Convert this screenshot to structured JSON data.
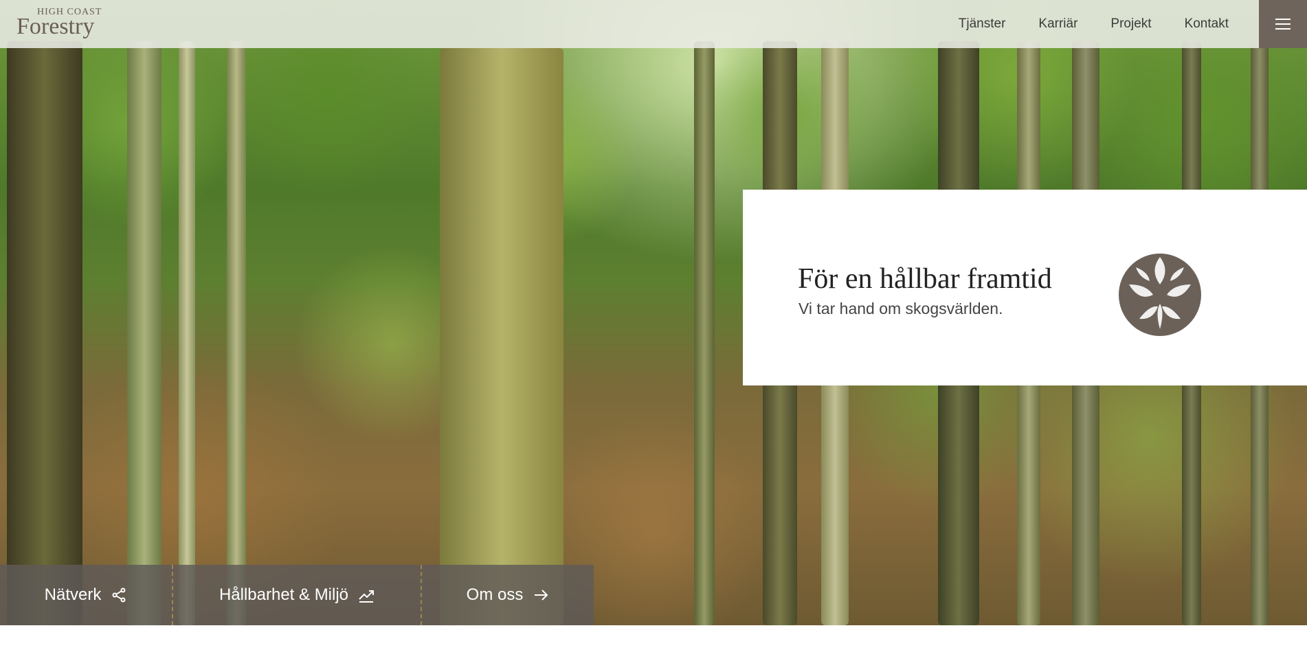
{
  "logo": {
    "top": "HIGH COAST",
    "main": "Forestry"
  },
  "nav": {
    "items": [
      {
        "label": "Tjänster"
      },
      {
        "label": "Karriär"
      },
      {
        "label": "Projekt"
      },
      {
        "label": "Kontakt"
      }
    ]
  },
  "hero": {
    "title": "För en hållbar framtid",
    "subtitle": "Vi tar hand om skogsvärlden."
  },
  "buttons": [
    {
      "label": "Nätverk",
      "icon": "share-icon"
    },
    {
      "label": "Hållbarhet & Miljö",
      "icon": "trending-up-icon"
    },
    {
      "label": "Om oss",
      "icon": "arrow-right-icon"
    }
  ],
  "colors": {
    "brand": "#6f645b",
    "nav_bg": "#ebece6"
  }
}
